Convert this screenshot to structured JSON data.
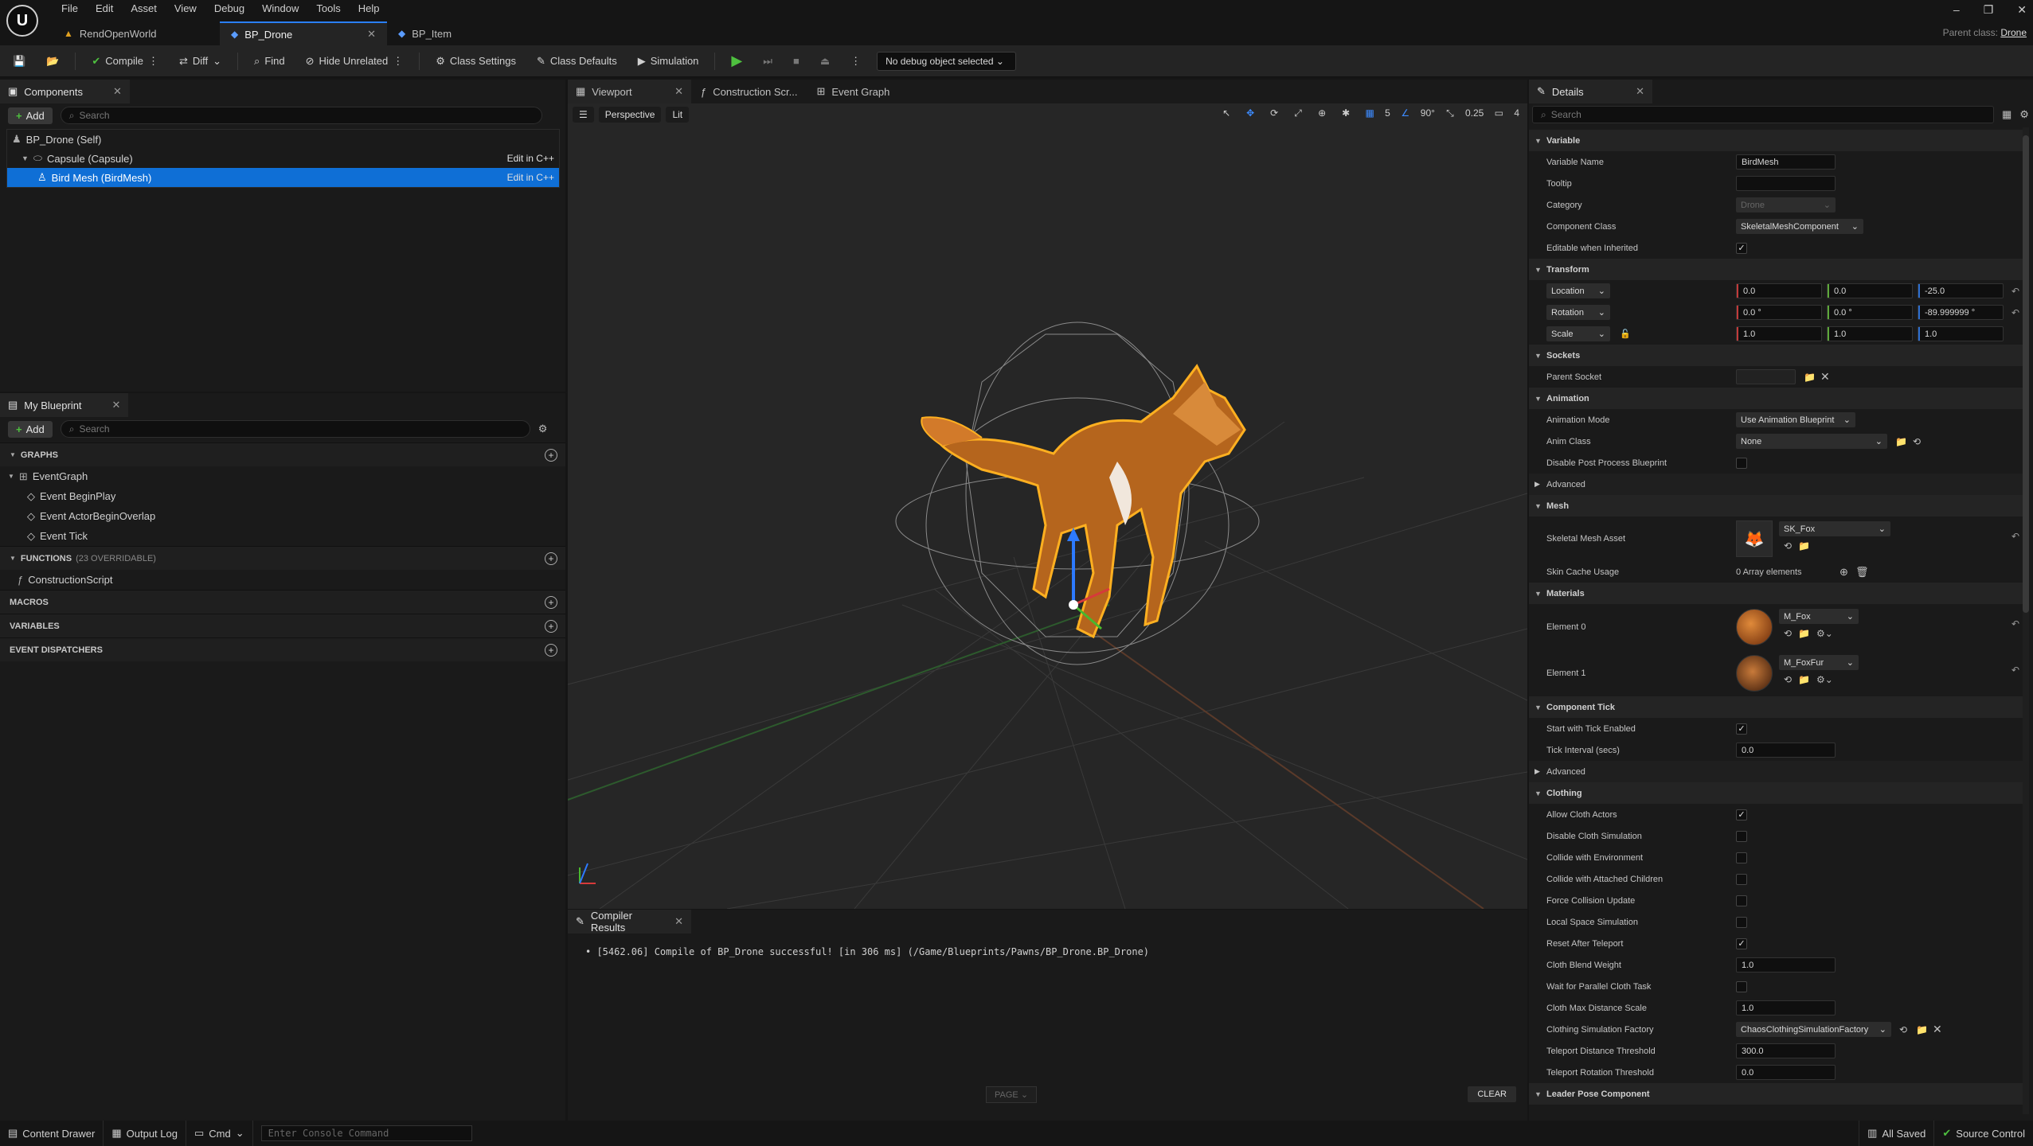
{
  "menu": [
    "File",
    "Edit",
    "Asset",
    "View",
    "Debug",
    "Window",
    "Tools",
    "Help"
  ],
  "doc_tabs": [
    {
      "label": "RendOpenWorld",
      "icon": "map-icon"
    },
    {
      "label": "BP_Drone",
      "icon": "blueprint-icon"
    },
    {
      "label": "BP_Item",
      "icon": "blueprint-icon"
    }
  ],
  "parent_class": {
    "label": "Parent class:",
    "value": "Drone"
  },
  "toolbar": {
    "compile": "Compile",
    "diff": "Diff",
    "find": "Find",
    "hide_unrelated": "Hide Unrelated",
    "class_settings": "Class Settings",
    "class_defaults": "Class Defaults",
    "simulation": "Simulation",
    "debug_object": "No debug object selected"
  },
  "components": {
    "tab": "Components",
    "add": "Add",
    "search_placeholder": "Search",
    "items": [
      {
        "label": "BP_Drone (Self)",
        "action": ""
      },
      {
        "label": "Capsule (Capsule)",
        "action": "Edit in C++"
      },
      {
        "label": "Bird Mesh (BirdMesh)",
        "action": "Edit in C++"
      }
    ]
  },
  "my_blueprint": {
    "tab": "My Blueprint",
    "add": "Add",
    "search_placeholder": "Search",
    "graphs_header": "GRAPHS",
    "event_graph": "EventGraph",
    "events": [
      "Event BeginPlay",
      "Event ActorBeginOverlap",
      "Event Tick"
    ],
    "functions_header": "FUNCTIONS",
    "functions_sub": "(23 OVERRIDABLE)",
    "construction_script": "ConstructionScript",
    "macros": "MACROS",
    "variables": "VARIABLES",
    "dispatchers": "EVENT DISPATCHERS"
  },
  "viewport_tabs": [
    "Viewport",
    "Construction Scr...",
    "Event Graph"
  ],
  "viewport": {
    "perspective": "Perspective",
    "lit": "Lit",
    "grid_snap": "5",
    "rot_snap": "90°",
    "scale_snap": "0.25",
    "cam_speed": "4"
  },
  "compiler": {
    "tab": "Compiler Results",
    "log": "[5462.06] Compile of BP_Drone successful! [in 306 ms] (/Game/Blueprints/Pawns/BP_Drone.BP_Drone)",
    "page": "PAGE",
    "clear": "CLEAR"
  },
  "details": {
    "tab": "Details",
    "search_placeholder": "Search",
    "variable": {
      "header": "Variable",
      "name_label": "Variable Name",
      "name": "BirdMesh",
      "tooltip_label": "Tooltip",
      "category_label": "Category",
      "category": "Drone",
      "class_label": "Component Class",
      "class": "SkeletalMeshComponent",
      "editable_label": "Editable when Inherited"
    },
    "transform": {
      "header": "Transform",
      "location": "Location",
      "rotation": "Rotation",
      "scale": "Scale",
      "loc": [
        "0.0",
        "0.0",
        "-25.0"
      ],
      "rot": [
        "0.0 °",
        "0.0 °",
        "-89.999999 °"
      ],
      "scl": [
        "1.0",
        "1.0",
        "1.0"
      ]
    },
    "sockets": {
      "header": "Sockets",
      "parent_socket": "Parent Socket"
    },
    "animation": {
      "header": "Animation",
      "mode_label": "Animation Mode",
      "mode": "Use Animation Blueprint",
      "class_label": "Anim Class",
      "class": "None",
      "disable_label": "Disable Post Process Blueprint",
      "advanced": "Advanced"
    },
    "mesh": {
      "header": "Mesh",
      "asset_label": "Skeletal Mesh Asset",
      "asset": "SK_Fox",
      "skin_label": "Skin Cache Usage",
      "skin": "0 Array elements"
    },
    "materials": {
      "header": "Materials",
      "e0_label": "Element 0",
      "e0": "M_Fox",
      "e1_label": "Element 1",
      "e1": "M_FoxFur"
    },
    "tick": {
      "header": "Component Tick",
      "start_label": "Start with Tick Enabled",
      "interval_label": "Tick Interval (secs)",
      "interval": "0.0",
      "advanced": "Advanced"
    },
    "clothing": {
      "header": "Clothing",
      "allow": "Allow Cloth Actors",
      "disable": "Disable Cloth Simulation",
      "collide_env": "Collide with Environment",
      "collide_children": "Collide with Attached Children",
      "force": "Force Collision Update",
      "local": "Local Space Simulation",
      "reset": "Reset After Teleport",
      "blend_label": "Cloth Blend Weight",
      "blend": "1.0",
      "wait": "Wait for Parallel Cloth Task",
      "maxdist_label": "Cloth Max Distance Scale",
      "maxdist": "1.0",
      "factory_label": "Clothing Simulation Factory",
      "factory": "ChaosClothingSimulationFactory",
      "tele_dist_label": "Teleport Distance Threshold",
      "tele_dist": "300.0",
      "tele_rot_label": "Teleport Rotation Threshold",
      "tele_rot": "0.0"
    },
    "leader": {
      "header": "Leader Pose Component"
    }
  },
  "status": {
    "content_drawer": "Content Drawer",
    "output_log": "Output Log",
    "cmd": "Cmd",
    "console_placeholder": "Enter Console Command",
    "all_saved": "All Saved",
    "source_control": "Source Control"
  }
}
